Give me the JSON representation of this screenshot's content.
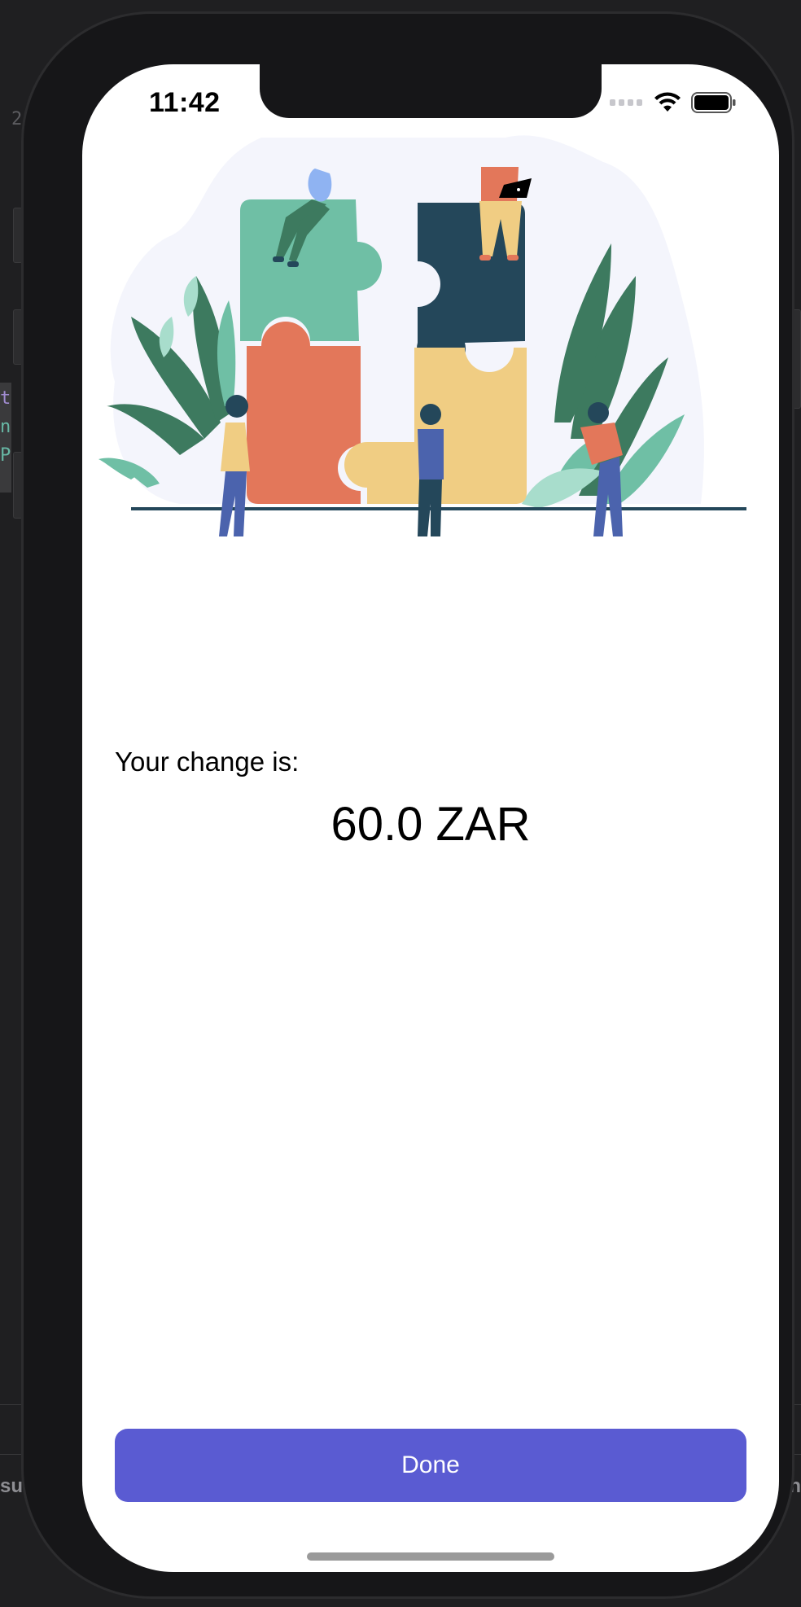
{
  "status_bar": {
    "time": "11:42"
  },
  "main": {
    "change_label": "Your change is:",
    "change_amount": "60.0 ZAR"
  },
  "actions": {
    "done_label": "Done"
  },
  "editor_background": {
    "line_number": "2",
    "code_chars": [
      "t",
      "n",
      "P"
    ],
    "footer_left": "su",
    "footer_right": "n"
  },
  "colors": {
    "accent": "#5a5bd2",
    "puzzle_green": "#6fbfa5",
    "puzzle_navy": "#24475a",
    "puzzle_coral": "#e3775a",
    "puzzle_yellow": "#f0cd83",
    "leaf_dark": "#3d7a5f"
  },
  "icons": {
    "signal": "cellular-signal-icon",
    "wifi": "wifi-icon",
    "battery": "battery-icon",
    "illustration": "puzzle-team-illustration"
  }
}
